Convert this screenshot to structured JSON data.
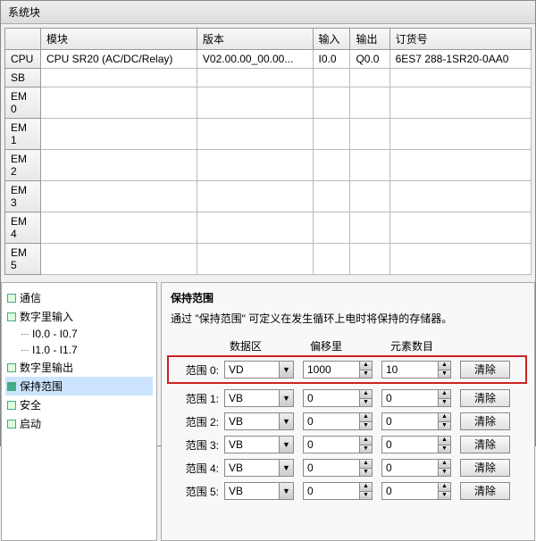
{
  "window": {
    "title": "系统块"
  },
  "grid": {
    "headers": [
      "",
      "模块",
      "版本",
      "输入",
      "输出",
      "订货号"
    ],
    "rowhdrs": [
      "CPU",
      "SB",
      "EM 0",
      "EM 1",
      "EM 2",
      "EM 3",
      "EM 4",
      "EM 5"
    ],
    "row0": {
      "module": "CPU SR20 (AC/DC/Relay)",
      "version": "V02.00.00_00.00...",
      "input": "I0.0",
      "output": "Q0.0",
      "order": "6ES7 288-1SR20-0AA0"
    }
  },
  "tree": {
    "items": [
      {
        "label": "通信"
      },
      {
        "label": "数字里输入",
        "children": [
          {
            "label": "I0.0 - I0.7"
          },
          {
            "label": "I1.0 - I1.7"
          }
        ]
      },
      {
        "label": "数字里输出"
      },
      {
        "label": "保持范围",
        "selected": true,
        "checked": true
      },
      {
        "label": "安全"
      },
      {
        "label": "启动"
      }
    ]
  },
  "panel": {
    "title": "保持范围",
    "desc": "通过 \"保持范围\" 可定义在发生循环上电时将保持的存储器。",
    "cols": {
      "data": "数据区",
      "offset": "偏移里",
      "count": "元素数目"
    },
    "clear": "清除",
    "rows": [
      {
        "label": "范围 0:",
        "data": "VD",
        "offset": "1000",
        "count": "10",
        "highlight": true
      },
      {
        "label": "范围 1:",
        "data": "VB",
        "offset": "0",
        "count": "0"
      },
      {
        "label": "范围 2:",
        "data": "VB",
        "offset": "0",
        "count": "0"
      },
      {
        "label": "范围 3:",
        "data": "VB",
        "offset": "0",
        "count": "0"
      },
      {
        "label": "范围 4:",
        "data": "VB",
        "offset": "0",
        "count": "0"
      },
      {
        "label": "范围 5:",
        "data": "VB",
        "offset": "0",
        "count": "0"
      }
    ]
  }
}
